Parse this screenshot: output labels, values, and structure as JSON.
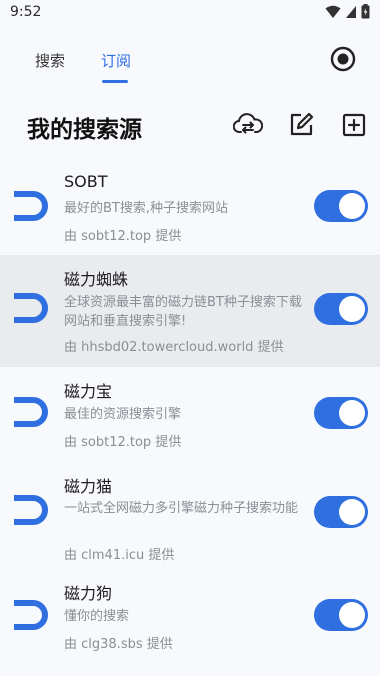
{
  "status": {
    "time": "9:52"
  },
  "tabs": [
    {
      "label": "搜索"
    },
    {
      "label": "订阅"
    }
  ],
  "page": {
    "title": "我的搜索源"
  },
  "colors": {
    "accent": "#2f6fe0",
    "text_secondary": "#8b8e94",
    "highlight_row": "#e9ebef"
  },
  "sources": [
    {
      "name": "SOBT",
      "desc": "最好的BT搜索,种子搜索网站",
      "provider": "由 sobt12.top 提供",
      "enabled": true
    },
    {
      "name": "磁力蜘蛛",
      "desc": "全球资源最丰富的磁力链BT种子搜索下载网站和垂直搜索引擎!",
      "provider": "由 hhsbd02.towercloud.world 提供",
      "enabled": true
    },
    {
      "name": "磁力宝",
      "desc": "最佳的资源搜索引擎",
      "provider": "由 sobt12.top 提供",
      "enabled": true
    },
    {
      "name": "磁力猫",
      "desc": "一站式全网磁力多引擎磁力种子搜索功能",
      "provider": "由 clm41.icu 提供",
      "enabled": true
    },
    {
      "name": "磁力狗",
      "desc": "懂你的搜索",
      "provider": "由 clg38.sbs 提供",
      "enabled": true
    }
  ]
}
